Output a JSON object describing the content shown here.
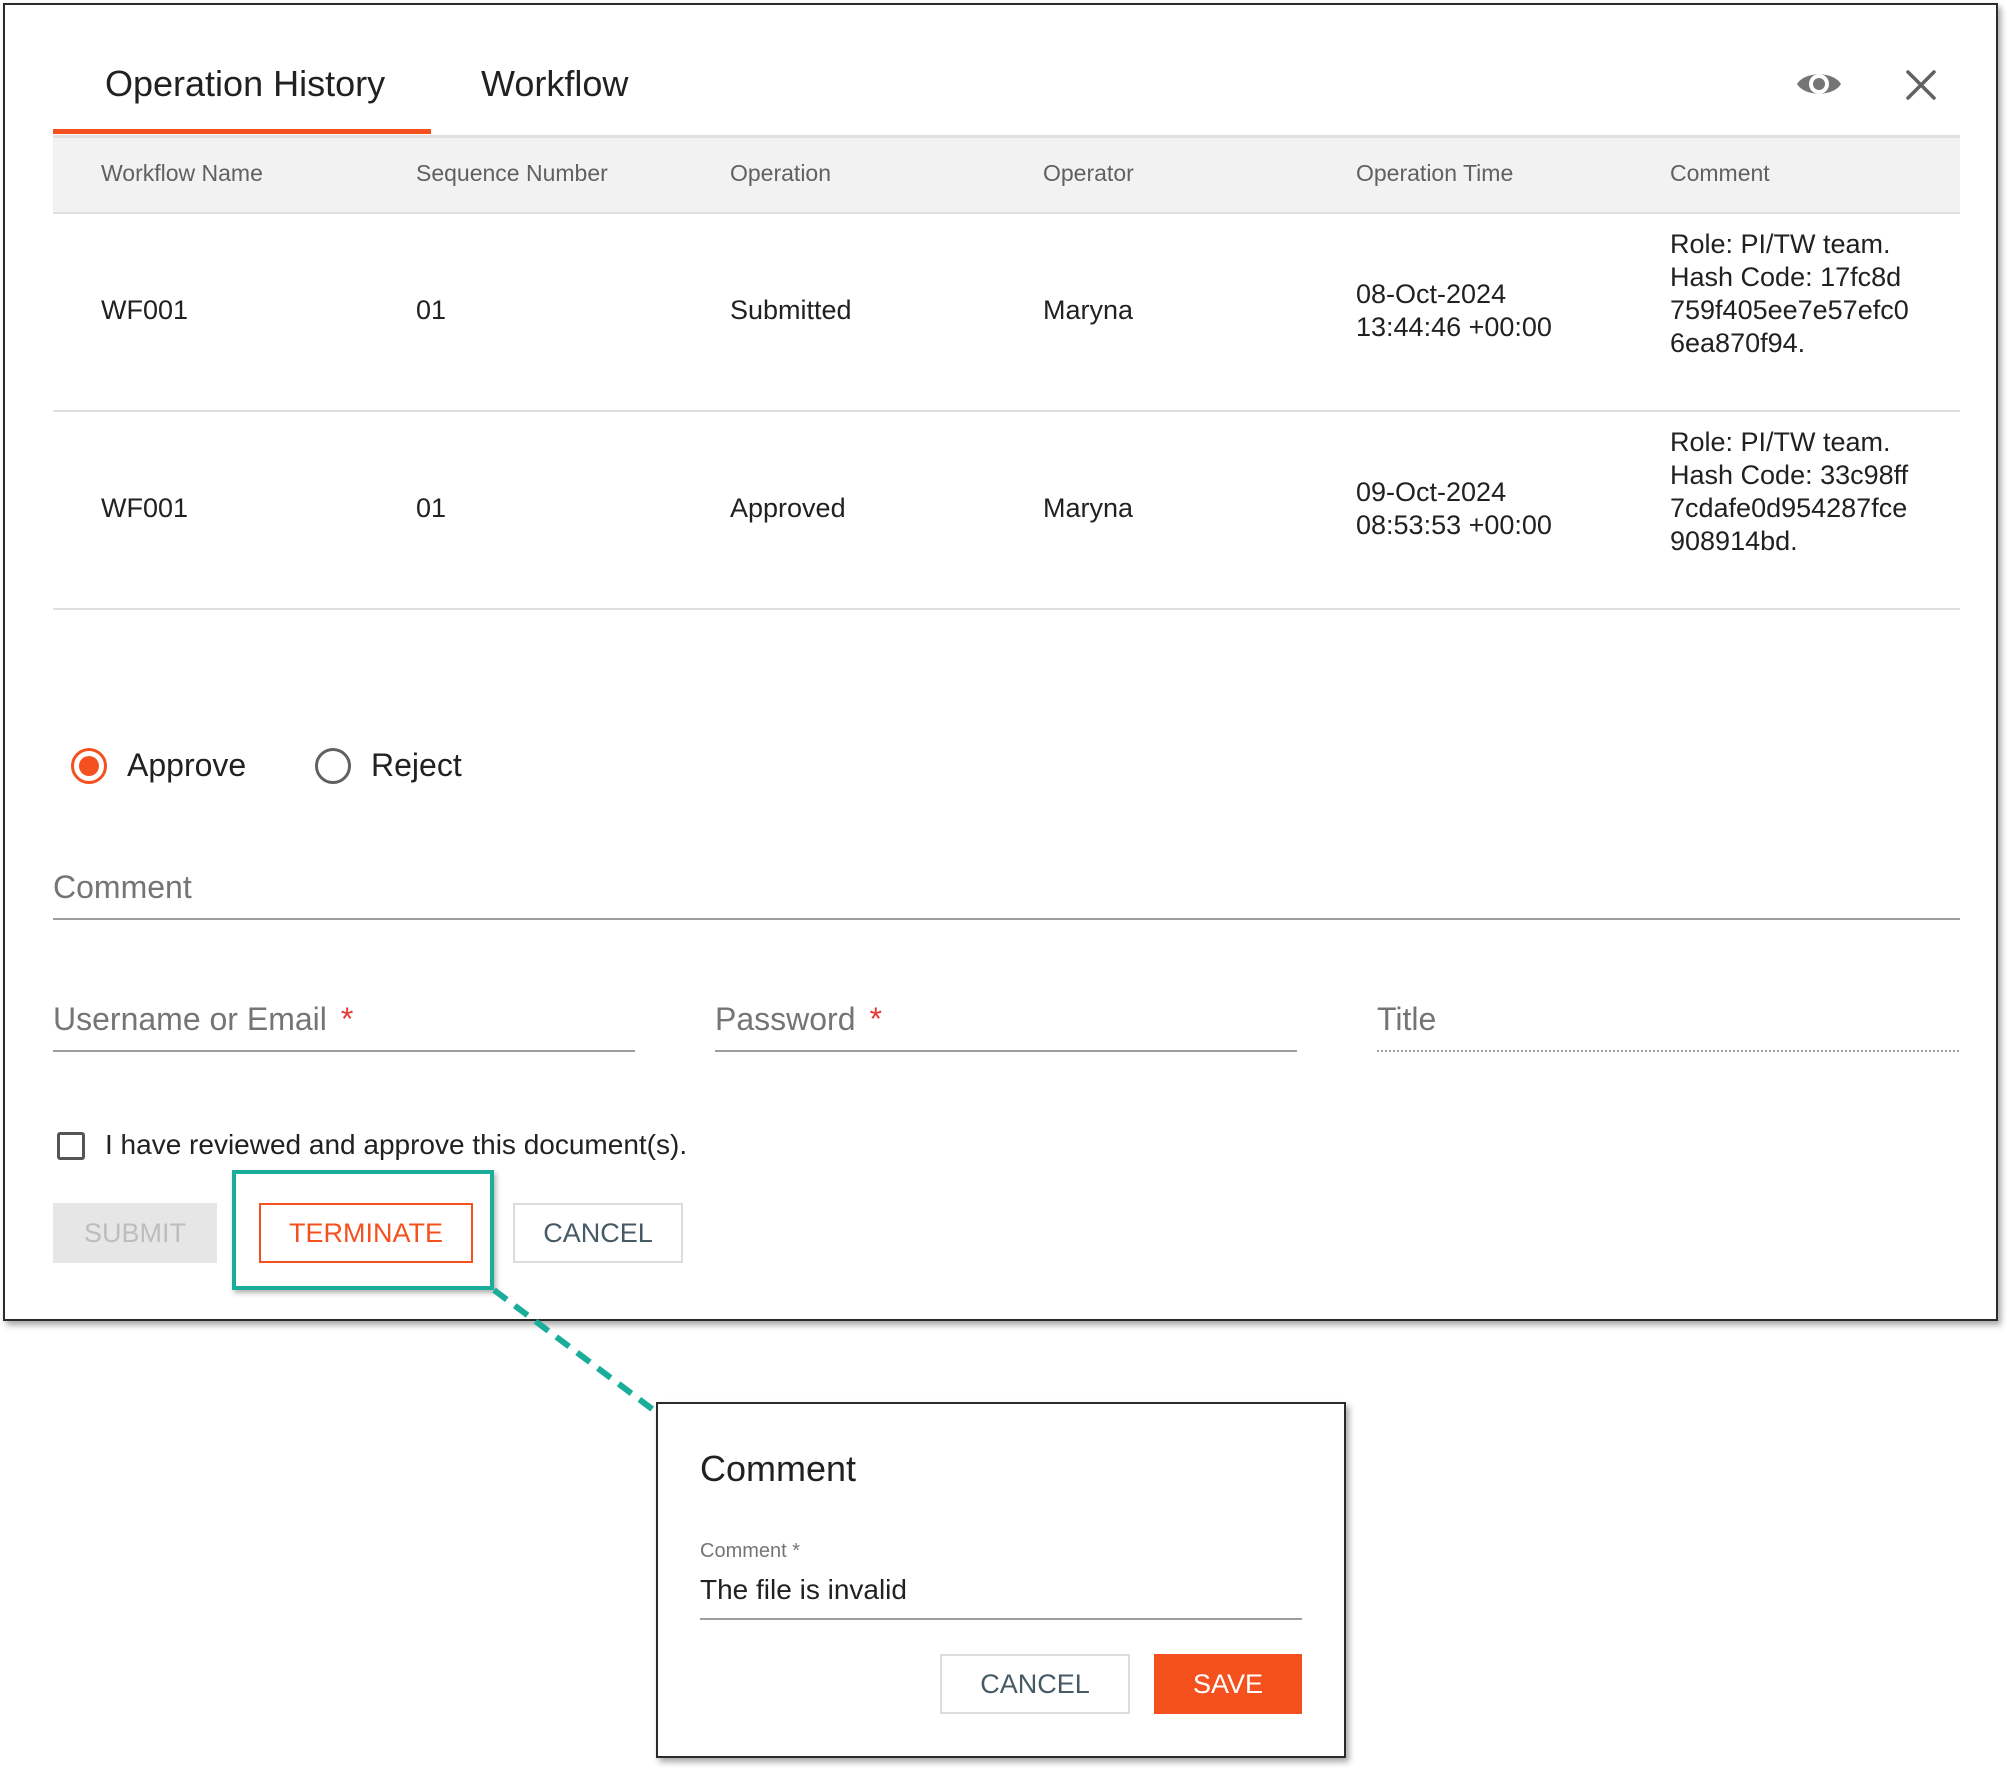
{
  "tabs": [
    {
      "label": "Operation History",
      "active": true
    },
    {
      "label": "Workflow",
      "active": false
    }
  ],
  "header_icons": {
    "preview": "eye-icon",
    "close": "close-icon"
  },
  "table": {
    "columns": [
      "Workflow Name",
      "Sequence Number",
      "Operation",
      "Operator",
      "Operation Time",
      "Comment"
    ],
    "rows": [
      {
        "workflow_name": "WF001",
        "sequence_number": "01",
        "operation": "Submitted",
        "operator": "Maryna",
        "time_date": "08-Oct-2024",
        "time_clock": "13:44:46 +00:00",
        "comment": "Role: PI/TW team. Hash Code: 17fc8d759f405ee7e57efc06ea870f94."
      },
      {
        "workflow_name": "WF001",
        "sequence_number": "01",
        "operation": "Approved",
        "operator": "Maryna",
        "time_date": "09-Oct-2024",
        "time_clock": "08:53:53 +00:00",
        "comment": "Role: PI/TW team. Hash Code: 33c98ff7cdafe0d954287fce908914bd."
      }
    ]
  },
  "decision": {
    "approve_label": "Approve",
    "reject_label": "Reject",
    "selected": "approve"
  },
  "form": {
    "comment_placeholder": "Comment",
    "username_label": "Username or Email",
    "password_label": "Password",
    "title_label": "Title",
    "required_mark": "*",
    "review_checkbox_label": "I have reviewed and approve this document(s)."
  },
  "buttons": {
    "submit": "SUBMIT",
    "terminate": "TERMINATE",
    "cancel": "CANCEL"
  },
  "dialog": {
    "title": "Comment",
    "field_label": "Comment *",
    "field_value": "The file is invalid",
    "cancel": "CANCEL",
    "save": "SAVE"
  },
  "colors": {
    "accent": "#f4511e",
    "highlight": "#1aae9a",
    "disabled_bg": "#e6e6e6"
  }
}
